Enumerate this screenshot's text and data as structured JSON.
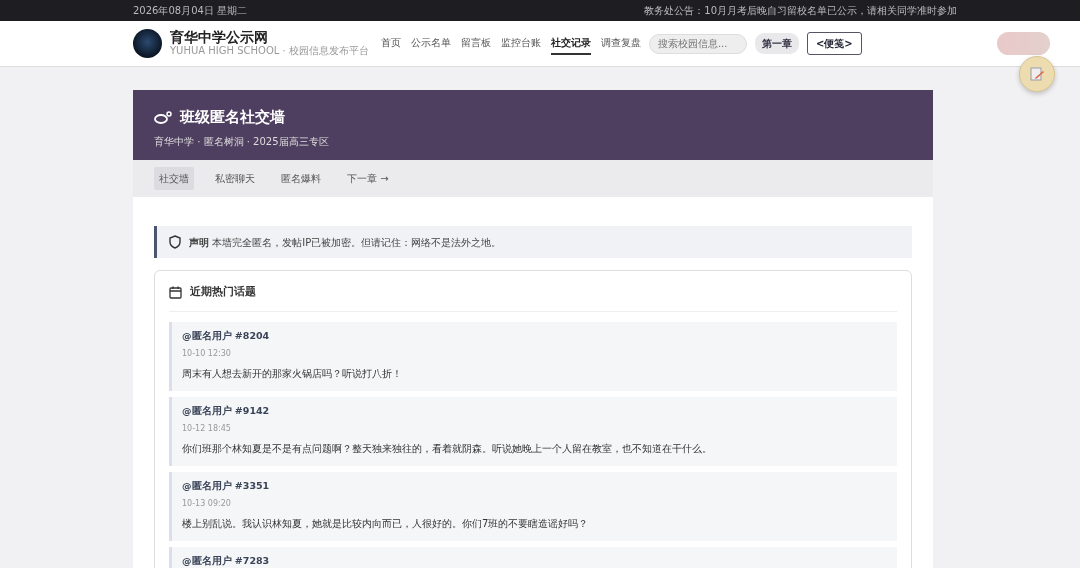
{
  "topbar": {
    "date": "2026年08月04日 星期二",
    "notice": "教务处公告：10月月考后晚自习留校名单已公示，请相关同学准时参加"
  },
  "header": {
    "site_title": "育华中学公示网",
    "subtitle": "YUHUA HIGH SCHOOL · 校园信息发布平台",
    "nav": [
      {
        "label": "首页",
        "selected": false
      },
      {
        "label": "公示名单",
        "selected": false
      },
      {
        "label": "留言板",
        "selected": false
      },
      {
        "label": "监控台账",
        "selected": false
      },
      {
        "label": "社交记录",
        "selected": true
      },
      {
        "label": "调查复盘",
        "selected": false
      }
    ],
    "search": {
      "placeholder": "搜索校园信息..."
    },
    "chapter": "第一章",
    "note_button": "<便笺>"
  },
  "banner": {
    "title": "班级匿名社交墙",
    "subtitle": "育华中学 · 匿名树洞 · 2025届高三专区"
  },
  "subnav": [
    {
      "label": "社交墙",
      "selected": true
    },
    {
      "label": "私密聊天",
      "selected": false
    },
    {
      "label": "匿名爆料",
      "selected": false
    },
    {
      "label": "下一章 →",
      "selected": false
    }
  ],
  "disclaimer": {
    "text": "**声明** 本墙完全匿名，发帖IP已被加密。但请记住：网络不是法外之地。"
  },
  "topics": {
    "title": "近期热门话题",
    "posts": [
      {
        "user": "@匿名用户 #8204",
        "time": "10-10 12:30",
        "text": "周末有人想去新开的那家火锅店吗？听说打八折！"
      },
      {
        "user": "@匿名用户 #9142",
        "time": "10-12 18:45",
        "text": "你们班那个林知夏是不是有点问题啊？整天独来独往的，看着就阴森。听说她晚上一个人留在教室，也不知道在干什么。"
      },
      {
        "user": "@匿名用户 #3351",
        "time": "10-13 09:20",
        "text": "楼上别乱说。我认识林知夏，她就是比较内向而已，人很好的。你们7班的不要瞎造谣好吗？"
      },
      {
        "user": "@匿名用户 #7283"
      }
    ]
  }
}
